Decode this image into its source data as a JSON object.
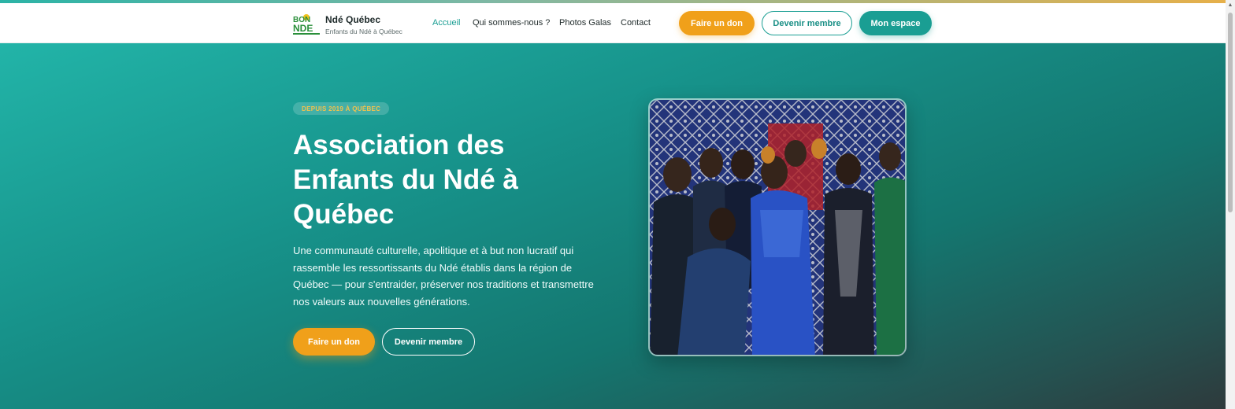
{
  "header": {
    "brand_title": "Ndé Québec",
    "brand_subtitle": "Enfants du Ndé à Québec",
    "logo_text": "BON NDE",
    "nav": [
      "Accueil",
      "Qui sommes-nous ?",
      "Photos Galas",
      "Contact"
    ],
    "active_nav": "Accueil",
    "buttons": {
      "don": "Faire un don",
      "membre": "Devenir membre",
      "espace": "Mon espace"
    }
  },
  "hero": {
    "badge": "DEPUIS 2019 À QUÉBEC",
    "title": "Association des Enfants du Ndé à Québec",
    "description": "Une communauté culturelle, apolitique et à but non lucratif qui rassemble les ressortissants du Ndé établis dans la région de Québec — pour s'entraider, préserver nos traditions et transmettre nos valeurs aux nouvelles générations.",
    "buttons": {
      "don": "Faire un don",
      "membre": "Devenir membre"
    },
    "photo_alt": "group-photo"
  },
  "colors": {
    "primary": "#1a9e93",
    "accent": "#f0a01a",
    "hero_dark": "#2e3a3c"
  }
}
